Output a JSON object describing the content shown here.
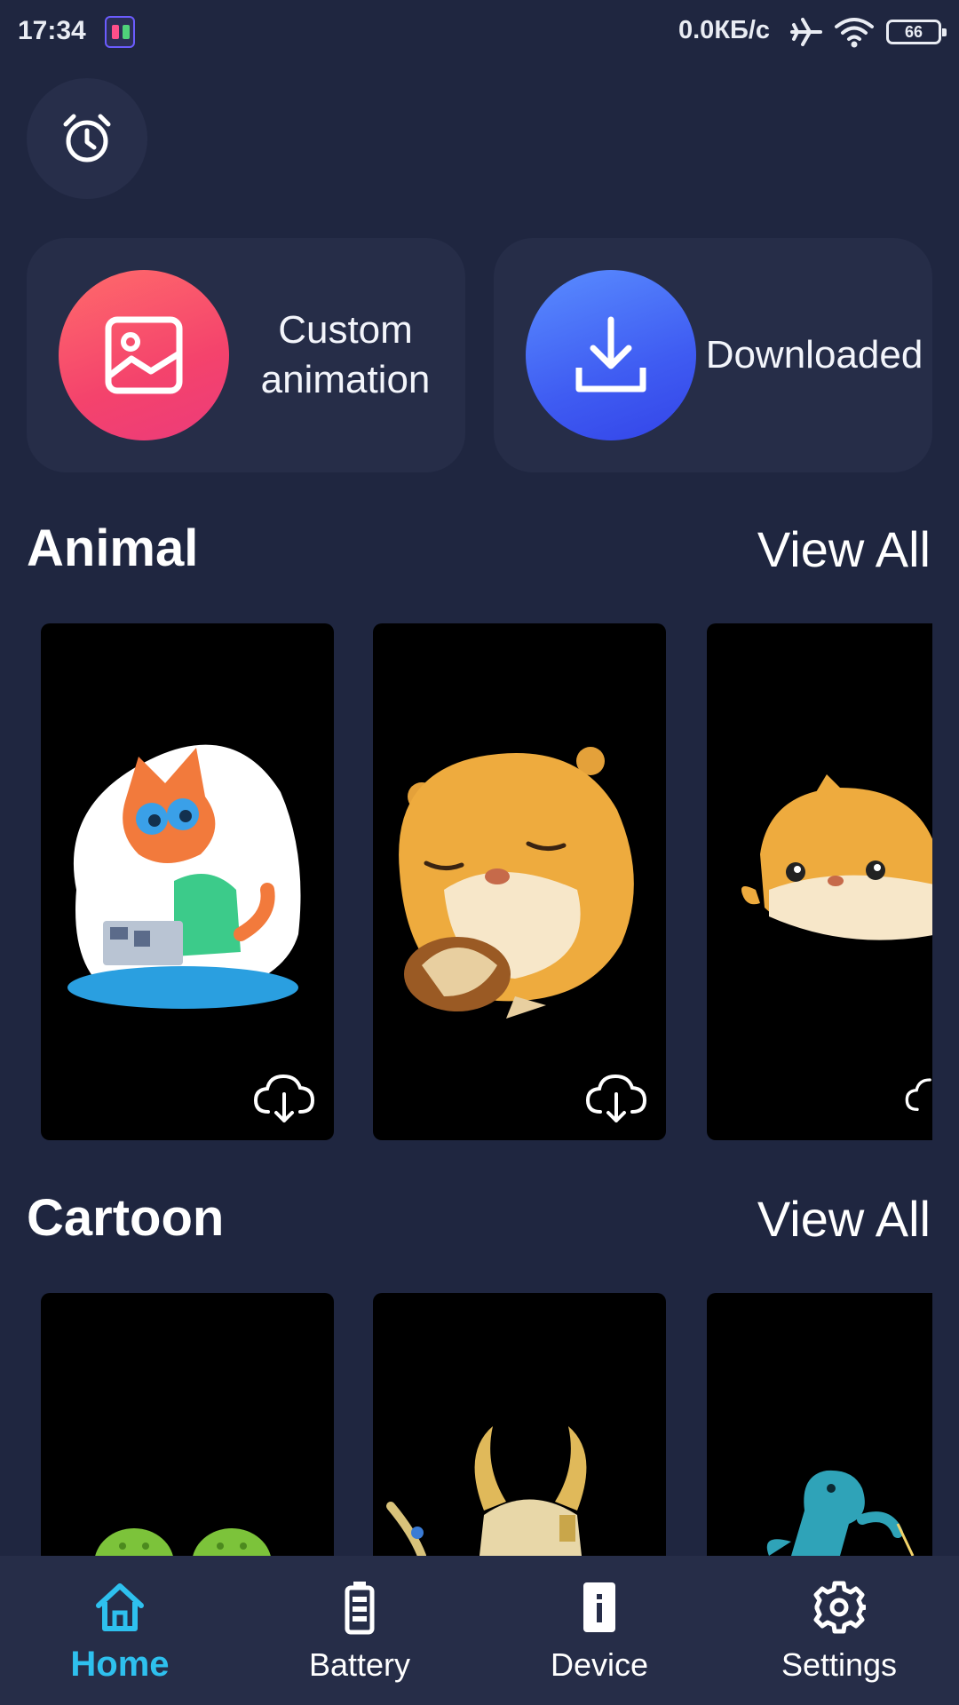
{
  "status_bar": {
    "time": "17:34",
    "net_speed": "0.0КБ/с",
    "battery": "66",
    "icons": [
      "app-icon",
      "airplane-icon",
      "wifi-icon",
      "battery-icon"
    ]
  },
  "header": {
    "alarm_icon": "alarm-clock-icon"
  },
  "quick_actions": [
    {
      "label": "Custom animation",
      "icon": "image-icon",
      "color": "#f4436c"
    },
    {
      "label": "Downloaded",
      "icon": "download-icon",
      "color": "#3f5cf2"
    }
  ],
  "sections": [
    {
      "title": "Animal",
      "view_all": "View All"
    },
    {
      "title": "Cartoon",
      "view_all": "View All"
    }
  ],
  "bottom_nav": {
    "items": [
      {
        "label": "Home",
        "icon": "home-icon",
        "active": true
      },
      {
        "label": "Battery",
        "icon": "battery-icon",
        "active": false
      },
      {
        "label": "Device",
        "icon": "device-info-icon",
        "active": false
      },
      {
        "label": "Settings",
        "icon": "gear-icon",
        "active": false
      }
    ],
    "active_color": "#2ec0ee"
  }
}
